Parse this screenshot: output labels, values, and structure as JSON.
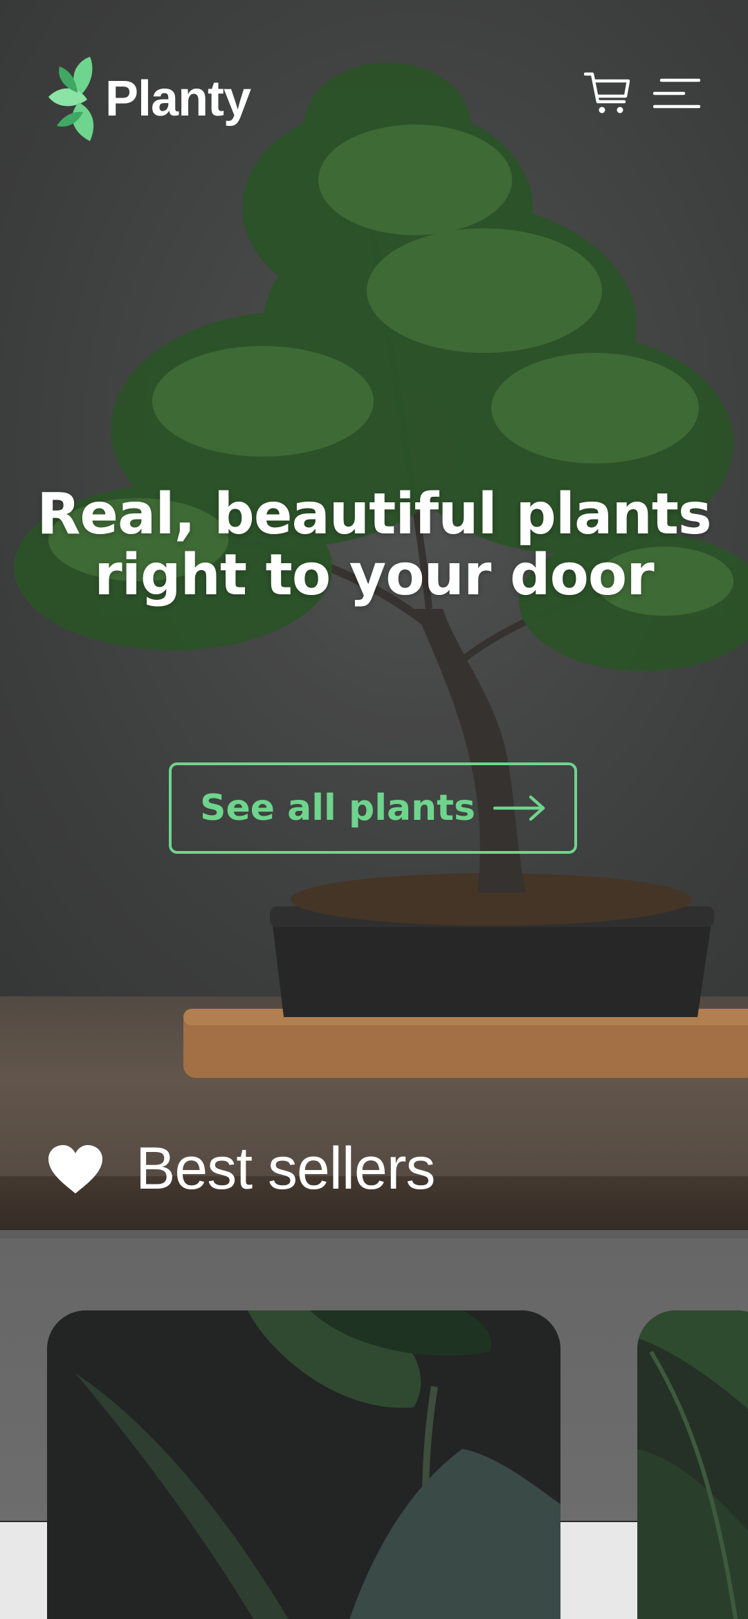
{
  "brand": {
    "name": "Planty",
    "accent_color": "#6fd48d"
  },
  "header": {
    "icons": [
      "cart-icon",
      "menu-icon"
    ]
  },
  "hero": {
    "title_line_1": "Real, beautiful plants",
    "title_line_2": "right to your door",
    "cta_label": "See all plants"
  },
  "best_sellers": {
    "title": "Best sellers",
    "icon": "heart-icon"
  }
}
